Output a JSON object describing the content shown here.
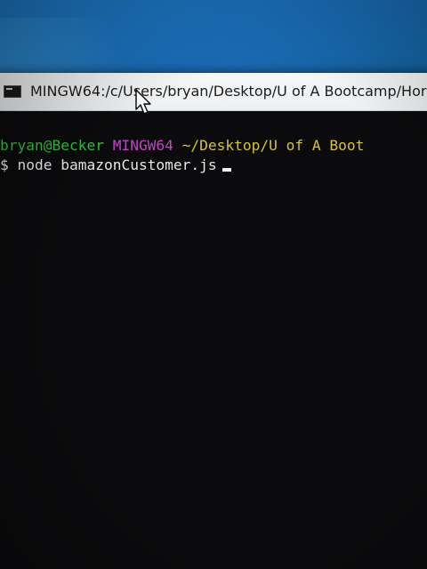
{
  "window": {
    "title": "MINGW64:/c/Users/bryan/Desktop/U of A Bootcamp/Hor",
    "app_icon": "terminal-icon"
  },
  "terminal": {
    "prompt": {
      "user_host": "bryan@Becker",
      "shell": "MINGW64",
      "cwd": "~/Desktop/U of A Boot"
    },
    "command_line": {
      "symbol": "$",
      "command": "node bamazonCustomer.js"
    }
  },
  "cursor": {
    "icon": "mouse-pointer-icon"
  },
  "colors": {
    "user_host": "#2fc23a",
    "shell": "#c542c8",
    "cwd": "#d5c33a",
    "terminal_bg": "#0b0b0d",
    "text": "#e8e8e8"
  }
}
